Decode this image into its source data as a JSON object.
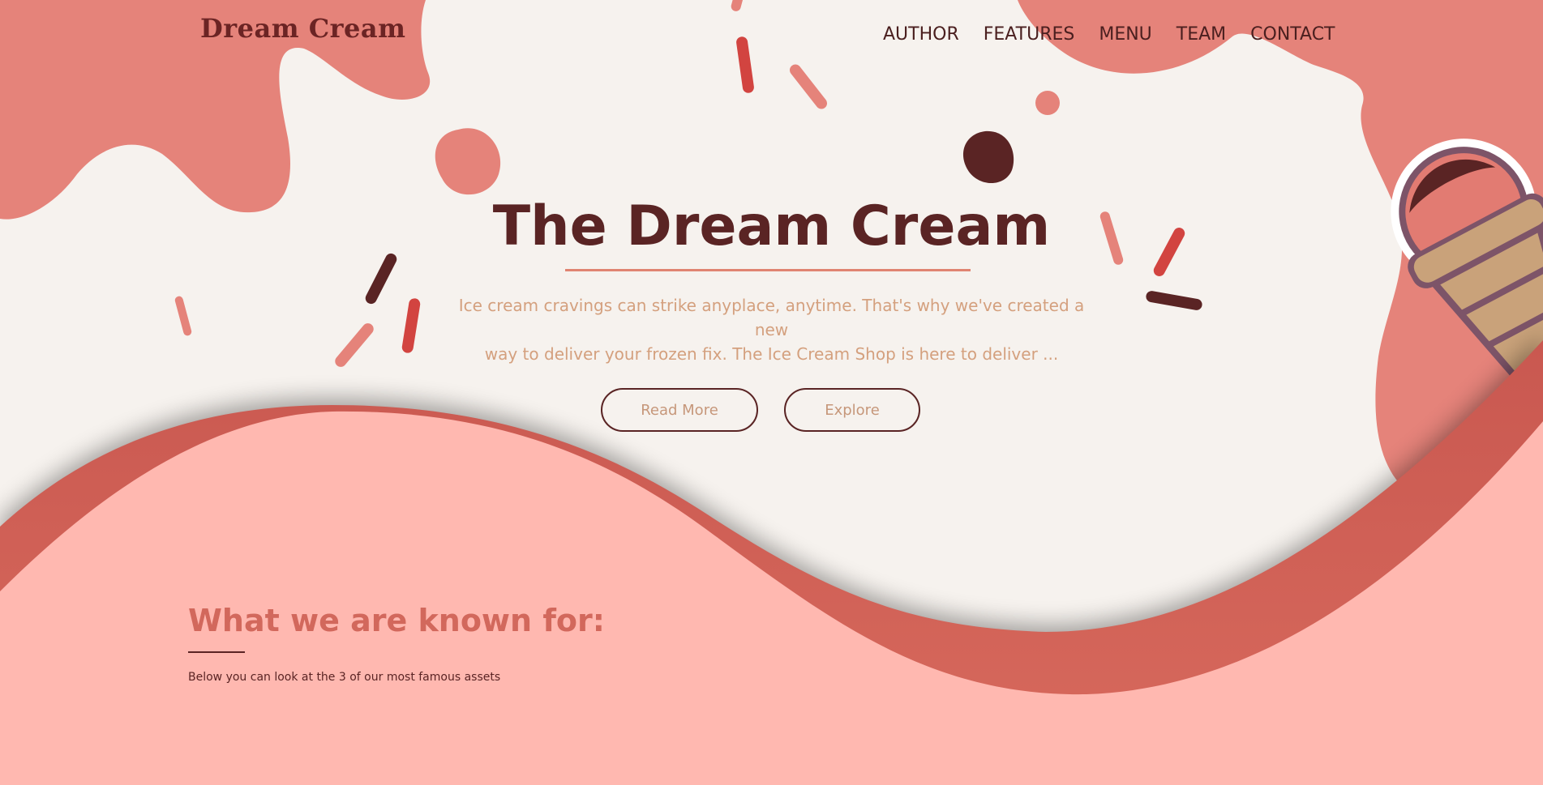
{
  "header": {
    "logo": "Dream Cream"
  },
  "nav": {
    "items": [
      "AUTHOR",
      "FEATURES",
      "MENU",
      "TEAM",
      "CONTACT"
    ]
  },
  "hero": {
    "title": "The Dream Cream",
    "description_line1": "Ice cream cravings can strike anyplace, anytime. That's why we've created a new",
    "description_line2": "way to deliver your frozen fix. The Ice Cream Shop is here to deliver ...",
    "read_more_label": "Read More",
    "explore_label": "Explore"
  },
  "section": {
    "title": "What we are known for:",
    "description": "Below you can look at the 3 of our most famous assets"
  },
  "colors": {
    "background": "#f6f2ee",
    "coral": "#e5837a",
    "pink": "#ffb8b0",
    "wave": "#d36157",
    "dark": "#5a2424"
  },
  "icons": [
    "ice-cream-cone-icon"
  ]
}
